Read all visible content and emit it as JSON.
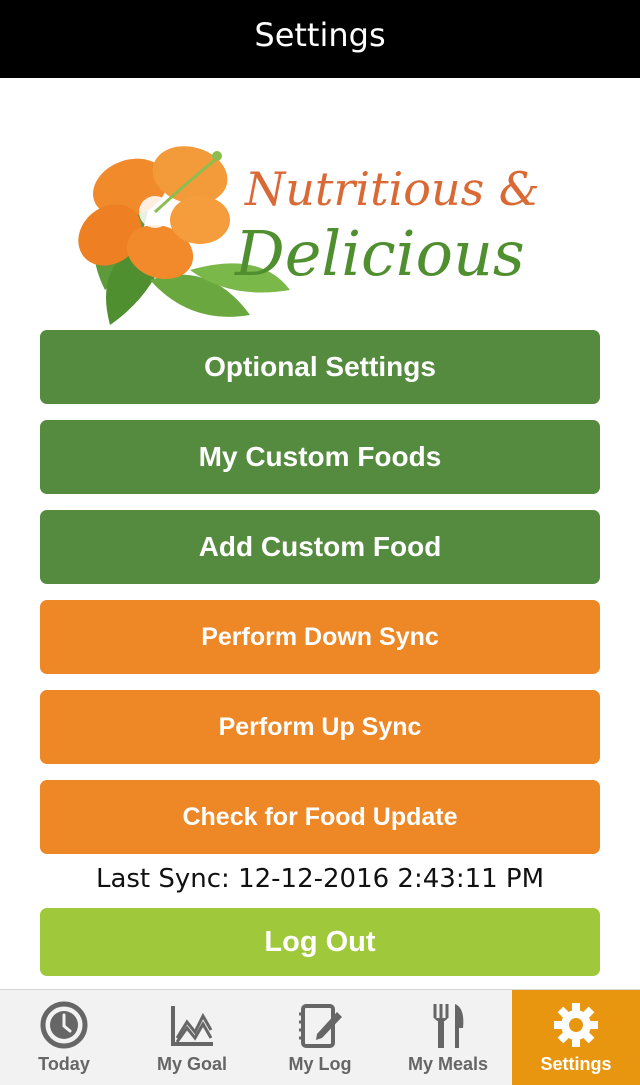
{
  "nav": {
    "title": "Settings"
  },
  "logo": {
    "line1": "Nutritious &",
    "line2": "Delicious"
  },
  "buttons": {
    "optional_settings": "Optional Settings",
    "my_custom_foods": "My Custom Foods",
    "add_custom_food": "Add Custom Food",
    "perform_down_sync": "Perform Down Sync",
    "perform_up_sync": "Perform Up Sync",
    "check_food_update": "Check for Food Update",
    "log_out": "Log Out"
  },
  "last_sync": "Last Sync: 12-12-2016 2:43:11 PM",
  "tabs": [
    {
      "label": "Today",
      "icon": "clock-icon"
    },
    {
      "label": "My Goal",
      "icon": "chart-icon"
    },
    {
      "label": "My Log",
      "icon": "notepad-icon"
    },
    {
      "label": "My Meals",
      "icon": "fork-knife-icon"
    },
    {
      "label": "Settings",
      "icon": "gear-icon",
      "active": true
    }
  ],
  "colors": {
    "nav_bg": "#000000",
    "green_button": "#558b3e",
    "orange_button": "#ee8725",
    "lime_button": "#9fc93b",
    "active_tab": "#e8960f",
    "logo_text": "#d96a36"
  }
}
